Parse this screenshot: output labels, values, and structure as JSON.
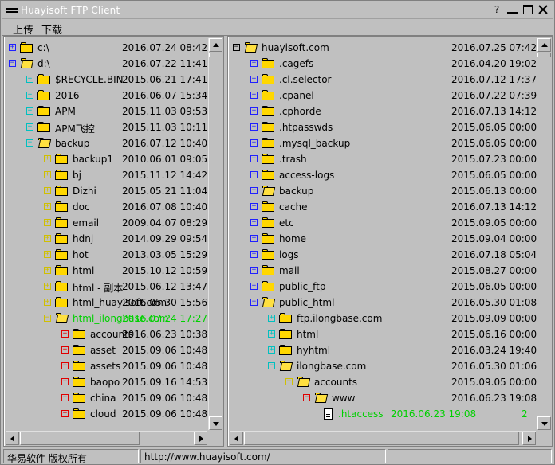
{
  "window": {
    "title": "Huayisoft FTP Client"
  },
  "title_buttons": {
    "help": "?"
  },
  "menu": {
    "upload": "上传",
    "download": "下载"
  },
  "left_tree": [
    {
      "depth": 0,
      "expander": "+",
      "exp_color": "blue",
      "icon": "folder",
      "name": "c:\\",
      "date": "2016.07.24 08:42"
    },
    {
      "depth": 0,
      "expander": "−",
      "exp_color": "blue",
      "icon": "folder-open",
      "name": "d:\\",
      "date": "2016.07.22 11:41"
    },
    {
      "depth": 1,
      "expander": "+",
      "exp_color": "cyan",
      "icon": "folder",
      "name": "$RECYCLE.BIN",
      "date": "2015.06.21 17:41"
    },
    {
      "depth": 1,
      "expander": "+",
      "exp_color": "cyan",
      "icon": "folder",
      "name": "2016",
      "date": "2016.06.07 15:34"
    },
    {
      "depth": 1,
      "expander": "+",
      "exp_color": "cyan",
      "icon": "folder",
      "name": "APM",
      "date": "2015.11.03 09:53"
    },
    {
      "depth": 1,
      "expander": "+",
      "exp_color": "cyan",
      "icon": "folder",
      "name": "APM飞控",
      "date": "2015.11.03 10:11"
    },
    {
      "depth": 1,
      "expander": "−",
      "exp_color": "cyan",
      "icon": "folder-open",
      "name": "backup",
      "date": "2016.07.12 10:40"
    },
    {
      "depth": 2,
      "expander": "+",
      "exp_color": "yellow",
      "icon": "folder",
      "name": "backup1",
      "date": "2010.06.01 09:05"
    },
    {
      "depth": 2,
      "expander": "+",
      "exp_color": "yellow",
      "icon": "folder",
      "name": "bj",
      "date": "2015.11.12 14:42"
    },
    {
      "depth": 2,
      "expander": "+",
      "exp_color": "yellow",
      "icon": "folder",
      "name": "Dizhi",
      "date": "2015.05.21 11:04"
    },
    {
      "depth": 2,
      "expander": "+",
      "exp_color": "yellow",
      "icon": "folder",
      "name": "doc",
      "date": "2016.07.08 10:40"
    },
    {
      "depth": 2,
      "expander": "+",
      "exp_color": "yellow",
      "icon": "folder",
      "name": "email",
      "date": "2009.04.07 08:29"
    },
    {
      "depth": 2,
      "expander": "+",
      "exp_color": "yellow",
      "icon": "folder",
      "name": "hdnj",
      "date": "2014.09.29 09:54"
    },
    {
      "depth": 2,
      "expander": "+",
      "exp_color": "yellow",
      "icon": "folder",
      "name": "hot",
      "date": "2013.03.05 15:29"
    },
    {
      "depth": 2,
      "expander": "+",
      "exp_color": "yellow",
      "icon": "folder",
      "name": "html",
      "date": "2015.10.12 10:59"
    },
    {
      "depth": 2,
      "expander": "+",
      "exp_color": "yellow",
      "icon": "folder",
      "name": "html - 副本",
      "date": "2015.06.12 13:47"
    },
    {
      "depth": 2,
      "expander": "+",
      "exp_color": "yellow",
      "icon": "folder",
      "name": "html_huayisoft.com",
      "date": "2016.05.30 15:56"
    },
    {
      "depth": 2,
      "expander": "−",
      "exp_color": "yellow",
      "icon": "folder-open",
      "name": "html_ilongbase.com",
      "date": "2016.07.24 17:27",
      "highlight": true
    },
    {
      "depth": 3,
      "expander": "+",
      "exp_color": "red",
      "icon": "folder",
      "name": "accounts",
      "date": "2016.06.23 10:38"
    },
    {
      "depth": 3,
      "expander": "+",
      "exp_color": "red",
      "icon": "folder",
      "name": "asset",
      "date": "2015.09.06 10:48"
    },
    {
      "depth": 3,
      "expander": "+",
      "exp_color": "red",
      "icon": "folder",
      "name": "assets",
      "date": "2015.09.06 10:48"
    },
    {
      "depth": 3,
      "expander": "+",
      "exp_color": "red",
      "icon": "folder",
      "name": "baopo",
      "date": "2015.09.16 14:53"
    },
    {
      "depth": 3,
      "expander": "+",
      "exp_color": "red",
      "icon": "folder",
      "name": "china",
      "date": "2015.09.06 10:48"
    },
    {
      "depth": 3,
      "expander": "+",
      "exp_color": "red",
      "icon": "folder",
      "name": "cloud",
      "date": "2015.09.06 10:48"
    }
  ],
  "right_tree": [
    {
      "depth": 0,
      "expander": "−",
      "exp_color": "black",
      "icon": "folder-open",
      "name": "huayisoft.com",
      "date": "2016.07.25 07:42"
    },
    {
      "depth": 1,
      "expander": "+",
      "exp_color": "blue",
      "icon": "folder",
      "name": ".cagefs",
      "date": "2016.04.20 19:02"
    },
    {
      "depth": 1,
      "expander": "+",
      "exp_color": "blue",
      "icon": "folder",
      "name": ".cl.selector",
      "date": "2016.07.12 17:37"
    },
    {
      "depth": 1,
      "expander": "+",
      "exp_color": "blue",
      "icon": "folder",
      "name": ".cpanel",
      "date": "2016.07.22 07:39"
    },
    {
      "depth": 1,
      "expander": "+",
      "exp_color": "blue",
      "icon": "folder",
      "name": ".cphorde",
      "date": "2016.07.13 14:12"
    },
    {
      "depth": 1,
      "expander": "+",
      "exp_color": "blue",
      "icon": "folder",
      "name": ".htpasswds",
      "date": "2015.06.05 00:00"
    },
    {
      "depth": 1,
      "expander": "+",
      "exp_color": "blue",
      "icon": "folder",
      "name": ".mysql_backup",
      "date": "2015.06.05 00:00"
    },
    {
      "depth": 1,
      "expander": "+",
      "exp_color": "blue",
      "icon": "folder",
      "name": ".trash",
      "date": "2015.07.23 00:00"
    },
    {
      "depth": 1,
      "expander": "+",
      "exp_color": "blue",
      "icon": "folder",
      "name": "access-logs",
      "date": "2015.06.05 00:00"
    },
    {
      "depth": 1,
      "expander": "−",
      "exp_color": "blue",
      "icon": "folder-open",
      "name": "backup",
      "date": "2015.06.13 00:00"
    },
    {
      "depth": 1,
      "expander": "+",
      "exp_color": "blue",
      "icon": "folder",
      "name": "cache",
      "date": "2016.07.13 14:12"
    },
    {
      "depth": 1,
      "expander": "+",
      "exp_color": "blue",
      "icon": "folder",
      "name": "etc",
      "date": "2015.09.05 00:00"
    },
    {
      "depth": 1,
      "expander": "+",
      "exp_color": "blue",
      "icon": "folder",
      "name": "home",
      "date": "2015.09.04 00:00"
    },
    {
      "depth": 1,
      "expander": "+",
      "exp_color": "blue",
      "icon": "folder",
      "name": "logs",
      "date": "2016.07.18 05:04"
    },
    {
      "depth": 1,
      "expander": "+",
      "exp_color": "blue",
      "icon": "folder",
      "name": "mail",
      "date": "2015.08.27 00:00"
    },
    {
      "depth": 1,
      "expander": "+",
      "exp_color": "blue",
      "icon": "folder",
      "name": "public_ftp",
      "date": "2015.06.05 00:00"
    },
    {
      "depth": 1,
      "expander": "−",
      "exp_color": "blue",
      "icon": "folder-open",
      "name": "public_html",
      "date": "2016.05.30 01:08"
    },
    {
      "depth": 2,
      "expander": "+",
      "exp_color": "cyan",
      "icon": "folder",
      "name": "ftp.ilongbase.com",
      "date": "2015.09.09 00:00"
    },
    {
      "depth": 2,
      "expander": "+",
      "exp_color": "cyan",
      "icon": "folder",
      "name": "html",
      "date": "2015.06.16 00:00"
    },
    {
      "depth": 2,
      "expander": "+",
      "exp_color": "cyan",
      "icon": "folder",
      "name": "hyhtml",
      "date": "2016.03.24 19:40"
    },
    {
      "depth": 2,
      "expander": "−",
      "exp_color": "cyan",
      "icon": "folder-open",
      "name": "ilongbase.com",
      "date": "2016.05.30 01:06"
    },
    {
      "depth": 3,
      "expander": "−",
      "exp_color": "yellow",
      "icon": "folder-open",
      "name": "accounts",
      "date": "2015.09.05 00:00"
    },
    {
      "depth": 4,
      "expander": "−",
      "exp_color": "red",
      "icon": "folder-open",
      "name": "www",
      "date": "2016.06.23 19:08"
    },
    {
      "depth": 5,
      "expander": "",
      "exp_color": "",
      "icon": "file",
      "name": ".htaccess",
      "date": "2016.06.23 19:08",
      "size": "2",
      "highlight": true
    }
  ],
  "status": {
    "copyright": "华易软件 版权所有",
    "url": "http://www.huayisoft.com/"
  }
}
